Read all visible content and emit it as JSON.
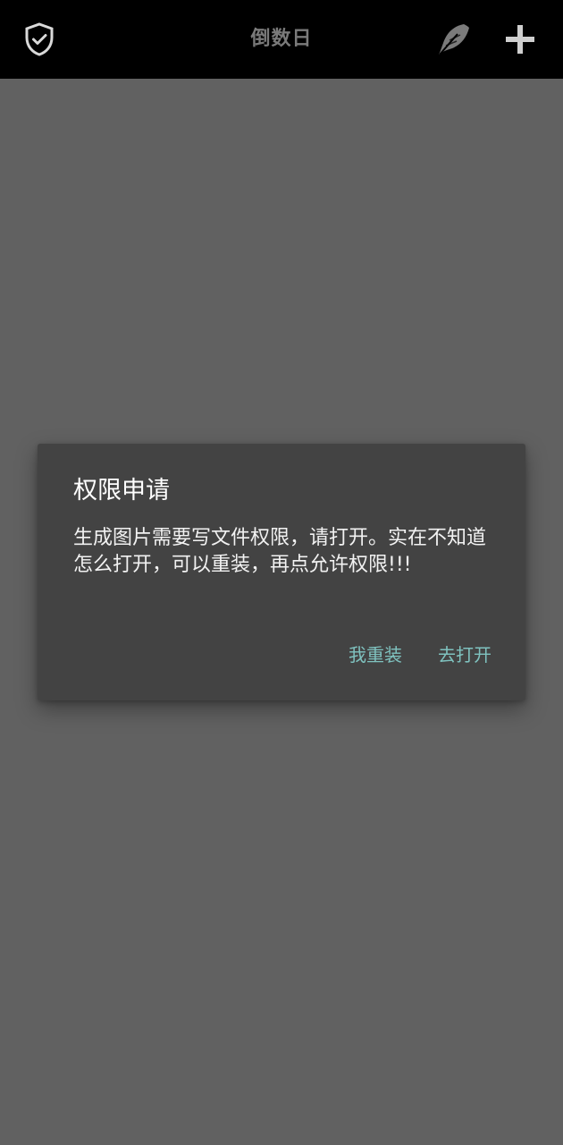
{
  "header": {
    "title": "倒数日",
    "icons": {
      "left": "shield-check-icon",
      "right_1": "feather-quill-icon",
      "right_2": "plus-icon"
    }
  },
  "dialog": {
    "title": "权限申请",
    "message": "生成图片需要写文件权限，请打开。实在不知道怎么打开，可以重装，再点允许权限!!!",
    "buttons": {
      "reinstall": "我重装",
      "open": "去打开"
    }
  },
  "colors": {
    "topbar_bg": "#000000",
    "scrim_bg": "#616161",
    "dialog_bg": "#434343",
    "accent": "#7fc2bf",
    "title_text": "#7a7a7a"
  }
}
